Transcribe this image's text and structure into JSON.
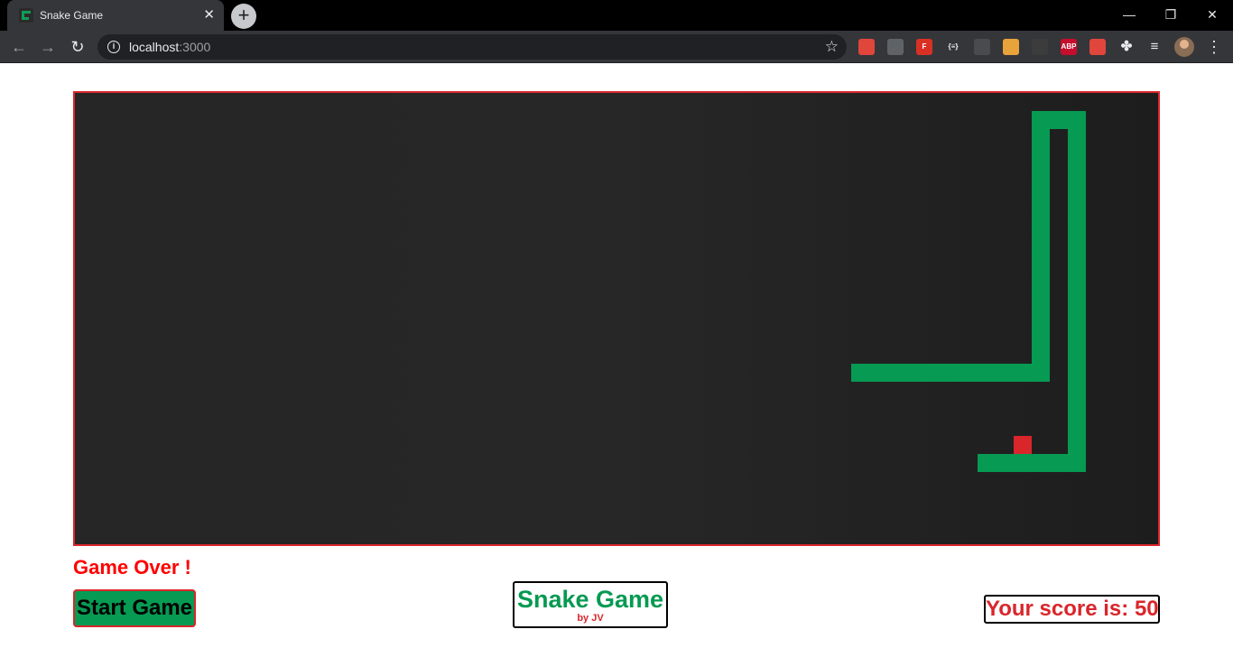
{
  "browser": {
    "tab_title": "Snake Game",
    "url_host": "localhost",
    "url_port": ":3000",
    "extensions": [
      {
        "name": "ext-1",
        "label": "",
        "color": "#e0463c"
      },
      {
        "name": "ext-2",
        "label": "",
        "color": "#5f6368"
      },
      {
        "name": "ext-3",
        "label": "F",
        "color": "#d93025"
      },
      {
        "name": "ext-4",
        "label": "{≡}",
        "color": "#35363a"
      },
      {
        "name": "ext-5",
        "label": "",
        "color": "#4a4b4e"
      },
      {
        "name": "ext-6",
        "label": "",
        "color": "#e8a33b"
      },
      {
        "name": "ext-7",
        "label": "",
        "color": "#3c3c3c"
      },
      {
        "name": "ext-abp",
        "label": "ABP",
        "color": "#c70d2c"
      },
      {
        "name": "ext-9",
        "label": "",
        "color": "#e0463c"
      }
    ]
  },
  "game": {
    "status": "Game Over !",
    "start_label": "Start Game",
    "title": "Snake Game",
    "author": "by JV",
    "score_text": "Your score is: 50",
    "score": 50,
    "colors": {
      "snake": "#069a52",
      "food": "#d9262b",
      "border": "#d9262b",
      "background": "#262626"
    },
    "grid": {
      "cols": 60,
      "rows": 25
    },
    "snake_path": [
      [
        43,
        15
      ],
      [
        53,
        15
      ],
      [
        53,
        1
      ],
      [
        55,
        1
      ],
      [
        55,
        20
      ],
      [
        50,
        20
      ]
    ],
    "food": [
      52,
      19
    ]
  }
}
